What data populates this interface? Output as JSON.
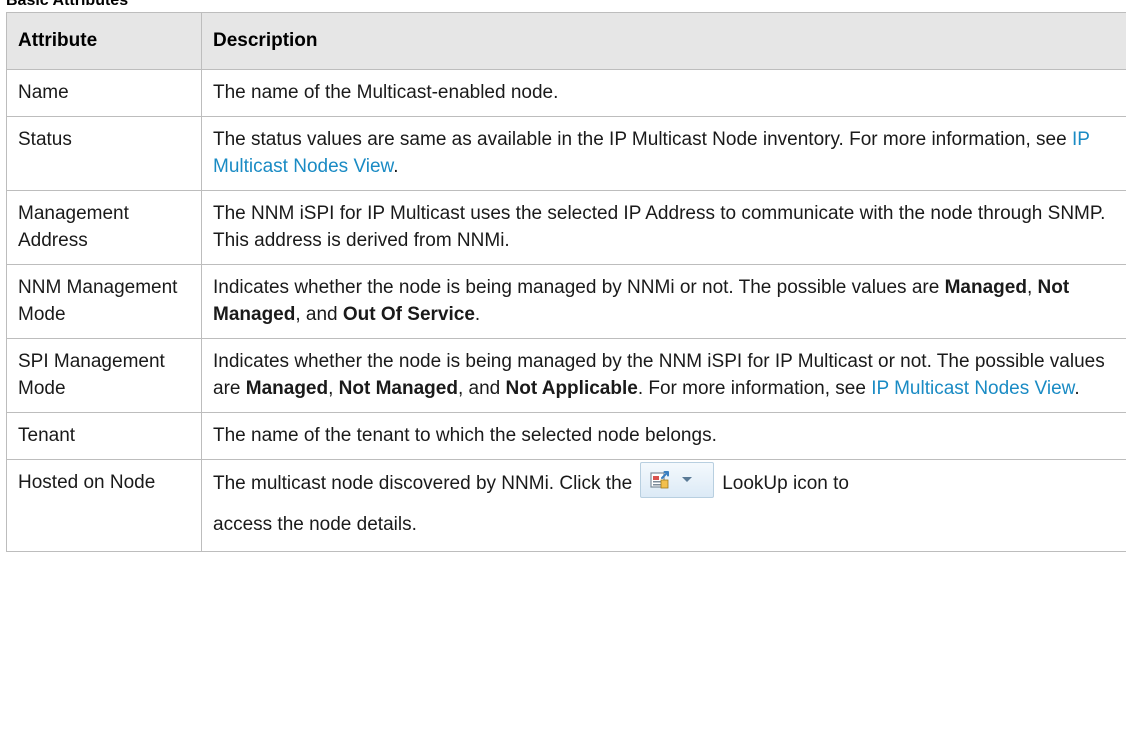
{
  "section_title": "Basic Attributes",
  "table": {
    "headers": [
      "Attribute",
      "Description"
    ],
    "rows": [
      {
        "attribute": "Name",
        "description": "The name of the Multicast-enabled node."
      },
      {
        "attribute": "Status",
        "description_pre": "The status values are same as available in the IP Multicast Node inventory. For more information, see ",
        "link": "IP Multicast Nodes View",
        "description_post": "."
      },
      {
        "attribute": "Management Address",
        "description": "The NNM iSPI for IP Multicast uses the selected IP Address to communicate with the node through SNMP. This address is derived from NNMi."
      },
      {
        "attribute": "NNM Management Mode",
        "description_pre": "Indicates whether the node is being managed by NNMi or not. The possible values are ",
        "v1": "Managed",
        "sep1": ", ",
        "v2": "Not Managed",
        "sep2": ", and ",
        "v3": "Out Of Service",
        "end": "."
      },
      {
        "attribute": "SPI Management Mode",
        "description_pre": "Indicates whether the node is being managed by the NNM iSPI for IP Multicast or not. The possible values are ",
        "v1": "Managed",
        "sep1": ", ",
        "v2": "Not Managed",
        "sep2": ", and ",
        "v3": "Not Applicable",
        "mid": ". For more information, see ",
        "link": "IP Multicast Nodes View",
        "end": "."
      },
      {
        "attribute": "Tenant",
        "description": "The name of the tenant to which the selected node belongs."
      },
      {
        "attribute": "Hosted on Node",
        "description_pre": "The multicast node discovered by NNMi. Click the",
        "icon": "lookup-icon",
        "description_mid": "LookUp icon to",
        "description_post": "access the node details."
      }
    ]
  },
  "colors": {
    "link": "#1a8bc4",
    "header_bg": "#e6e6e6",
    "border": "#bdbdbd"
  }
}
